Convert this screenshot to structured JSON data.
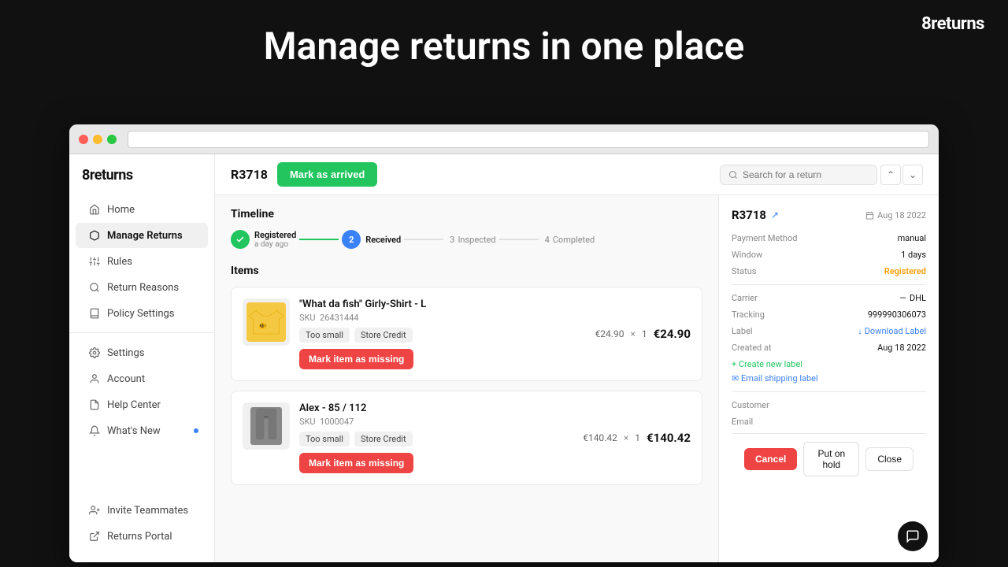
{
  "brand": {
    "logo": "8returns",
    "eight": "8",
    "returns": "returns"
  },
  "hero": {
    "title": "Manage returns in one place"
  },
  "sidebar": {
    "brand_label": "8returns",
    "items": [
      {
        "id": "home",
        "label": "Home",
        "icon": "home-icon",
        "active": false
      },
      {
        "id": "manage-returns",
        "label": "Manage Returns",
        "icon": "box-icon",
        "active": true
      },
      {
        "id": "rules",
        "label": "Rules",
        "icon": "sliders-icon",
        "active": false
      },
      {
        "id": "return-reasons",
        "label": "Return Reasons",
        "icon": "search-icon",
        "active": false
      },
      {
        "id": "policy-settings",
        "label": "Policy Settings",
        "icon": "book-icon",
        "active": false
      }
    ],
    "bottom_items": [
      {
        "id": "settings",
        "label": "Settings",
        "icon": "gear-icon"
      },
      {
        "id": "account",
        "label": "Account",
        "icon": "user-icon"
      },
      {
        "id": "help-center",
        "label": "Help Center",
        "icon": "doc-icon"
      },
      {
        "id": "whats-new",
        "label": "What's New",
        "icon": "bell-icon",
        "has_dot": true
      }
    ],
    "footer_items": [
      {
        "id": "invite-teammates",
        "label": "Invite Teammates",
        "icon": "invite-icon"
      },
      {
        "id": "returns-portal",
        "label": "Returns Portal",
        "icon": "portal-icon"
      }
    ]
  },
  "topbar": {
    "return_id": "R3718",
    "mark_arrived_label": "Mark as arrived",
    "search_placeholder": "Search for a return"
  },
  "timeline": {
    "section_title": "Timeline",
    "steps": [
      {
        "id": "registered",
        "label": "Registered",
        "sublabel": "a day ago",
        "state": "completed",
        "num": ""
      },
      {
        "id": "received",
        "label": "Received",
        "state": "active",
        "num": "2"
      },
      {
        "id": "inspected",
        "label": "Inspected",
        "state": "inactive",
        "num": "3"
      },
      {
        "id": "completed",
        "label": "Completed",
        "state": "inactive",
        "num": "4"
      }
    ]
  },
  "items": {
    "section_title": "Items",
    "list": [
      {
        "id": "item-1",
        "name": "\"What da fish\" Girly-Shirt - L",
        "sku_label": "SKU",
        "sku": "26431444",
        "tags": [
          "Too small",
          "Store Credit"
        ],
        "unit_price": "€24.90",
        "qty": "1",
        "total_price": "€24.90",
        "mark_missing_label": "Mark item as missing",
        "image_type": "tshirt"
      },
      {
        "id": "item-2",
        "name": "Alex - 85 / 112",
        "sku_label": "SKU",
        "sku": "1000047",
        "tags": [
          "Too small",
          "Store Credit"
        ],
        "unit_price": "€140.42",
        "qty": "1",
        "total_price": "€140.42",
        "mark_missing_label": "Mark item as missing",
        "image_type": "pants"
      }
    ]
  },
  "right_panel": {
    "return_id": "R3718",
    "date_label": "Aug 18 2022",
    "fields": [
      {
        "label": "Payment Method",
        "value": "manual"
      },
      {
        "label": "Window",
        "value": "1 days"
      },
      {
        "label": "Status",
        "value": "Registered",
        "type": "status"
      },
      {
        "label": "Carrier",
        "value": "DHL",
        "carrier_icon": "—"
      },
      {
        "label": "Tracking",
        "value": "999990306073"
      },
      {
        "label": "Label",
        "value": "Download Label",
        "type": "link"
      },
      {
        "label": "Created at",
        "value": "Aug 18 2022"
      }
    ],
    "action_links": [
      {
        "id": "create-label",
        "label": "+ Create new label",
        "type": "green"
      },
      {
        "id": "email-label",
        "label": "✉ Email shipping label",
        "type": "blue"
      }
    ],
    "customer_label": "Customer",
    "email_label": "Email"
  },
  "action_bar": {
    "cancel_label": "Cancel",
    "hold_label": "Put on hold",
    "close_label": "Close"
  }
}
